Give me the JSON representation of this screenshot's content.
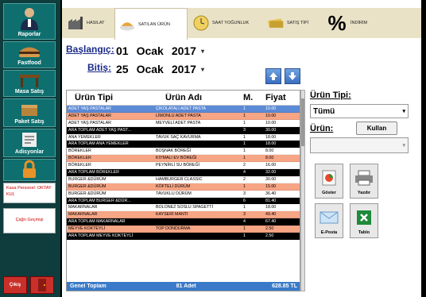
{
  "sidebar": {
    "buttons": [
      "Raporlar",
      "Fastfood",
      "Masa Satış",
      "Paket Satış",
      "Adisyonlar"
    ],
    "kasa_personel": "Kasa Personel: OKTAY KUL",
    "cagri_gecmisi": "Çağrı Geçmişi",
    "exit_label": "Çıkış"
  },
  "tabs": [
    {
      "label": "HASILAT",
      "icon": "factory-icon"
    },
    {
      "label": "SATILAN ÜRÜN",
      "icon": "food-icon"
    },
    {
      "label": "SAAT YOĞUNLUK",
      "icon": "clock-icon"
    },
    {
      "label": "SATIŞ TİPİ",
      "icon": "money-icon"
    },
    {
      "label": "İNDİRİM",
      "icon": "percent-icon"
    }
  ],
  "dates": {
    "start_label": "Başlangıç:",
    "start": {
      "day": "01",
      "month": "Ocak",
      "year": "2017"
    },
    "end_label": "Bitiş:",
    "end": {
      "day": "25",
      "month": "Ocak",
      "year": "2017"
    }
  },
  "table": {
    "headers": [
      "Ürün Tipi",
      "Ürün Adı",
      "M.",
      "Fiyat"
    ],
    "rows": [
      {
        "style": "selected",
        "c1": "ADET YAŞ PASTALAR",
        "c2": "ÇIKOLATALI ADET PASTA",
        "c3": "1",
        "c4": "10.00"
      },
      {
        "style": "orange",
        "c1": "ADET YAŞ PASTALAR",
        "c2": "LİMONLU ADET PASTA",
        "c3": "1",
        "c4": "10.00"
      },
      {
        "style": "white",
        "c1": "ADET YAŞ PASTALAR",
        "c2": "MEYVELİ ADET PASTA",
        "c3": "1",
        "c4": "10.00"
      },
      {
        "style": "black",
        "c1": "ARA TOPLAM    ADET YAŞ PAST...",
        "c2": "",
        "c3": "3",
        "c4": "30.00"
      },
      {
        "style": "white",
        "c1": "ANA YEMEKLER",
        "c2": "TAVUK SAÇ KAVURMA",
        "c3": "1",
        "c4": "18.00"
      },
      {
        "style": "black",
        "c1": "ARA TOPLAM    ANA YEMEKLER",
        "c2": "",
        "c3": "1",
        "c4": "18.00"
      },
      {
        "style": "white",
        "c1": "BÖREKLER",
        "c2": "BOŞNAK BÖREĞİ",
        "c3": "1",
        "c4": "8.00"
      },
      {
        "style": "orange",
        "c1": "BÖREKLER",
        "c2": "KIYMALI EV BÖREĞİ",
        "c3": "1",
        "c4": "8.00"
      },
      {
        "style": "white",
        "c1": "BÖREKLER",
        "c2": "PEYNİRLİ SU BÖREĞİ",
        "c3": "2",
        "c4": "16.00"
      },
      {
        "style": "black",
        "c1": "ARA TOPLAM    BÖREKLER",
        "c2": "",
        "c3": "4",
        "c4": "32.00"
      },
      {
        "style": "white",
        "c1": "BURGER &DÜRÜM",
        "c2": "HAMBURGER CLASSIC",
        "c3": "2",
        "c4": "30.00"
      },
      {
        "style": "orange",
        "c1": "BURGER &DÜRÜM",
        "c2": "KÖFTELİ DÜRÜM",
        "c3": "1",
        "c4": "15.00"
      },
      {
        "style": "white",
        "c1": "BURGER &DÜRÜM",
        "c2": "TAVUKLU DÜRÜM",
        "c3": "3",
        "c4": "36.40"
      },
      {
        "style": "black",
        "c1": "ARA TOPLAM    BURGER &DÜR...",
        "c2": "",
        "c3": "6",
        "c4": "81.40"
      },
      {
        "style": "white",
        "c1": "MAKARNALAR",
        "c2": "BOLONEZ SOSLU SPAGETTİ",
        "c3": "1",
        "c4": "18.00"
      },
      {
        "style": "orange",
        "c1": "MAKARNALAR",
        "c2": "KAYSERİ MANTI",
        "c3": "3",
        "c4": "49.40"
      },
      {
        "style": "black",
        "c1": "ARA TOPLAM    MAKARNALAR",
        "c2": "",
        "c3": "4",
        "c4": "67.40"
      },
      {
        "style": "orange",
        "c1": "MEYVE KOKTEYLİ",
        "c2": "TOP DONDURMA",
        "c3": "1",
        "c4": "2.50"
      },
      {
        "style": "black",
        "c1": "ARA TOPLAM    MEYVE KOKTEYLİ",
        "c2": "",
        "c3": "1",
        "c4": "2.50"
      }
    ],
    "footer": {
      "label": "Genel Toplam",
      "count": "81 Adet",
      "total": "628.85 TL"
    }
  },
  "right_panel": {
    "urun_tipi_label": "Ürün Tipi:",
    "urun_tipi_value": "Tümü",
    "urun_label": "Ürün:",
    "kullan_label": "Kullan",
    "urun_value": ""
  },
  "actions": {
    "goster": "Göster",
    "yazdir": "Yazdır",
    "eposta": "E-Posta",
    "tablo": "Tablo"
  }
}
